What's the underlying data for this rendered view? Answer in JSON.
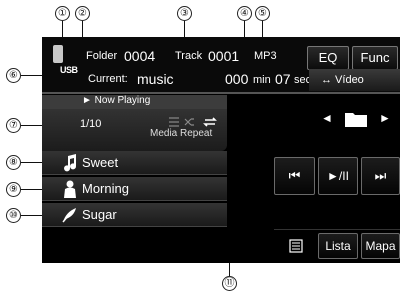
{
  "callouts": [
    "①",
    "②",
    "③",
    "④",
    "⑤",
    "⑥",
    "⑦",
    "⑧",
    "⑨",
    "⑩",
    "⑪"
  ],
  "header": {
    "usb_label": "USB",
    "folder_label": "Folder",
    "folder_number": "0004",
    "track_label": "Track",
    "track_number": "0001",
    "format": "MP3",
    "current_label": "Current:",
    "current_value": "music",
    "time_min_value": "000",
    "time_min_unit": "min",
    "time_sec_value": "07",
    "time_sec_unit": "sec"
  },
  "buttons": {
    "eq": "EQ",
    "func": "Func",
    "video": "↔ Vídeo",
    "lista": "Lista",
    "mapa": "Mapa"
  },
  "now_playing": {
    "label": "► Now Playing",
    "index": "1/10",
    "mode": "Media Repeat"
  },
  "list": [
    {
      "label": "Sweet",
      "icon": "music-note-icon"
    },
    {
      "label": "Morning",
      "icon": "artist-icon"
    },
    {
      "label": "Sugar",
      "icon": "album-icon"
    }
  ],
  "controls": {
    "prev_folder": "◄",
    "next_folder": "►",
    "prev_track": "⏮",
    "play_pause": "►/II",
    "next_track": "⏭"
  },
  "colors": {
    "screen_bg": "#000000",
    "panel_bg": "#2b2b2b",
    "text": "#ffffff"
  }
}
